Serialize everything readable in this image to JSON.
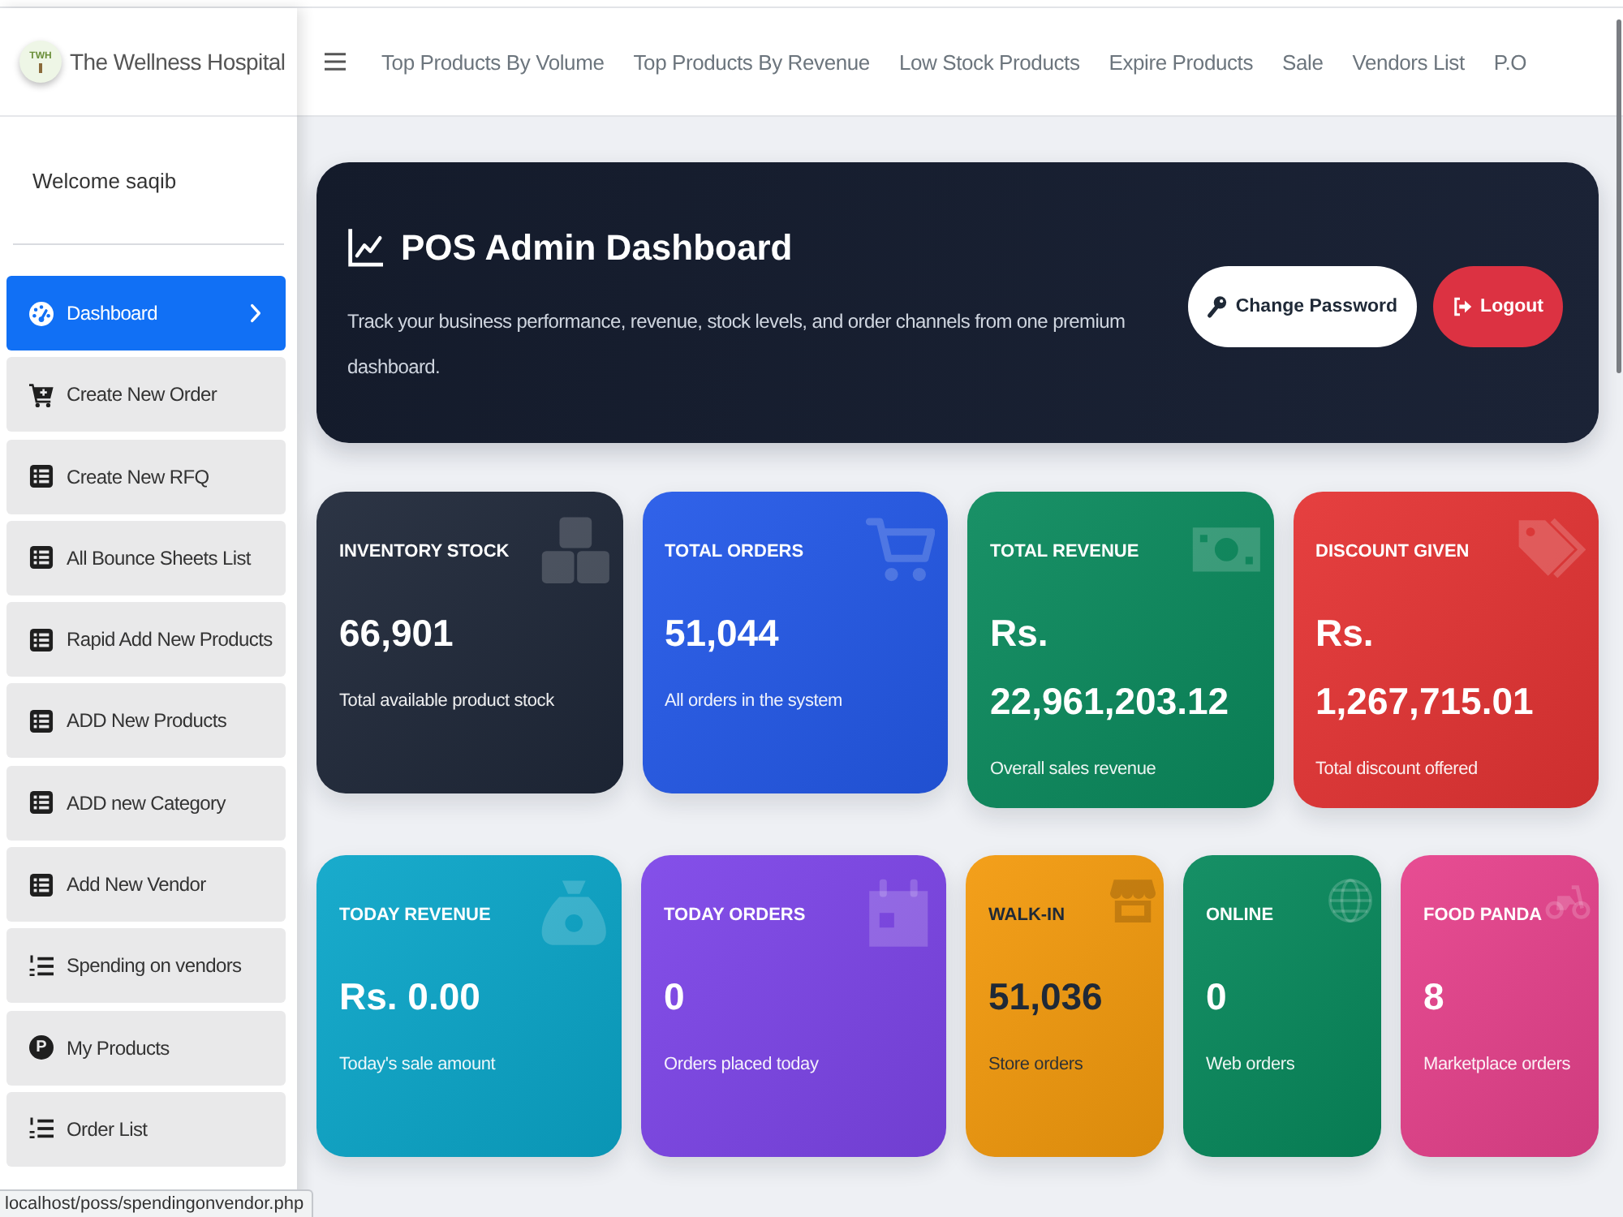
{
  "sidebar": {
    "brand": {
      "logo_text": "TWH",
      "name": "The Wellness Hospital"
    },
    "welcome": "Welcome saqib",
    "items": [
      {
        "label": "Dashboard",
        "selected": true
      },
      {
        "label": "Create New Order",
        "selected": false
      },
      {
        "label": "Create New RFQ",
        "selected": false
      },
      {
        "label": "All Bounce Sheets List",
        "selected": false
      },
      {
        "label": "Rapid Add New Products",
        "selected": false
      },
      {
        "label": "ADD New Products",
        "selected": false
      },
      {
        "label": "ADD new Category",
        "selected": false
      },
      {
        "label": "Add New Vendor",
        "selected": false
      },
      {
        "label": "Spending on vendors",
        "selected": false
      },
      {
        "label": "My Products",
        "selected": false,
        "icon_letter": "P"
      },
      {
        "label": "Order List",
        "selected": false
      }
    ]
  },
  "navbar": {
    "links": [
      "Top Products By Volume",
      "Top Products By Revenue",
      "Low Stock Products",
      "Expire Products",
      "Sale",
      "Vendors List",
      "P.O"
    ]
  },
  "hero": {
    "title": "POS Admin Dashboard",
    "subtitle": "Track your business performance, revenue, stock levels, and order channels from one premium dashboard.",
    "buttons": [
      {
        "label": "Change Password",
        "kind": "light"
      },
      {
        "label": "Logout",
        "kind": "danger"
      }
    ]
  },
  "summary_cards": [
    {
      "label": "INVENTORY STOCK",
      "value": "66,901",
      "caption": "Total available product stock",
      "color": "#1f2839",
      "dark_text": false
    },
    {
      "label": "TOTAL ORDERS",
      "value": "51,044",
      "caption": "All orders in the system",
      "color": "#2459e8",
      "dark_text": false
    },
    {
      "label": "TOTAL REVENUE",
      "value": "Rs. 22,961,203.12",
      "caption": "Overall sales revenue",
      "color": "#0b8a5d",
      "dark_text": false
    },
    {
      "label": "DISCOUNT GIVEN",
      "value": "Rs. 1,267,715.01",
      "caption": "Total discount offered",
      "color": "#e43434",
      "dark_text": false
    }
  ],
  "today_cards": [
    {
      "label": "TODAY REVENUE",
      "value": "Rs. 0.00",
      "caption": "Today's sale amount",
      "color": "#0ba6c9",
      "dark_text": false
    },
    {
      "label": "TODAY ORDERS",
      "value": "0",
      "caption": "Orders placed today",
      "color": "#7d45e8",
      "dark_text": false
    },
    {
      "label": "WALK-IN",
      "value": "51,036",
      "caption": "Store orders",
      "color": "#f39a0d",
      "dark_text": true
    },
    {
      "label": "ONLINE",
      "value": "0",
      "caption": "Web orders",
      "color": "#08895c",
      "dark_text": false
    },
    {
      "label": "FOOD PANDA",
      "value": "8",
      "caption": "Marketplace orders",
      "color": "#e6428c",
      "dark_text": false
    }
  ],
  "status_url": "localhost/poss/spendingonvendor.php"
}
